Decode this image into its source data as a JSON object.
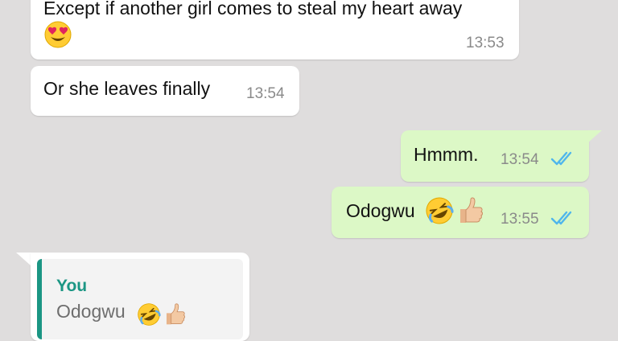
{
  "chat": {
    "messages": [
      {
        "direction": "incoming",
        "text": "Except if another girl comes to steal my heart away",
        "time": "13:53",
        "emoji": [
          "heart-eyes-emoji"
        ]
      },
      {
        "direction": "incoming",
        "text": "Or she leaves finally",
        "time": "13:54"
      },
      {
        "direction": "outgoing",
        "text": "Hmmm.",
        "time": "13:54",
        "status": "read"
      },
      {
        "direction": "outgoing",
        "text": "Odogwu",
        "time": "13:55",
        "status": "read",
        "emoji": [
          "rofl-emoji",
          "thumbs-up-emoji"
        ]
      }
    ],
    "reply": {
      "quoted_author": "You",
      "quoted_text": "Odogwu",
      "quoted_emoji": [
        "rofl-emoji",
        "thumbs-up-emoji"
      ]
    }
  },
  "colors": {
    "background": "#dfdddd",
    "incoming_bubble": "#ffffff",
    "outgoing_bubble": "#dcf8c6",
    "read_ticks": "#4fb6ec",
    "quote_accent": "#1b9684"
  }
}
